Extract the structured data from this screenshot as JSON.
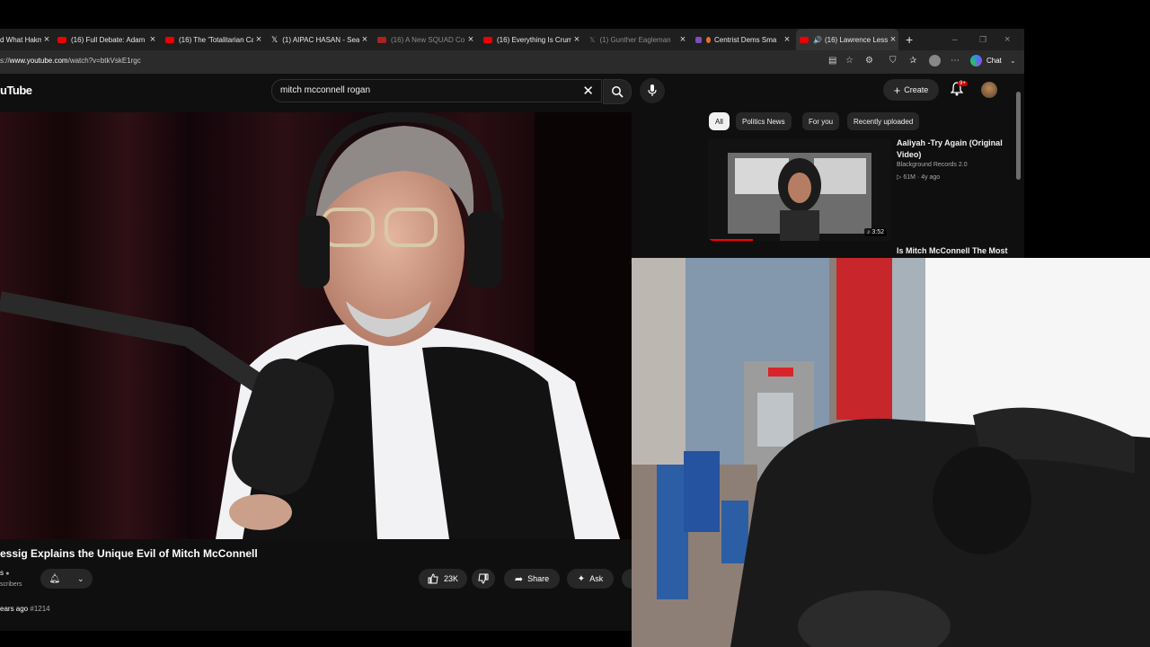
{
  "browser": {
    "tabs": [
      {
        "label": "d What Hakm",
        "dim": false,
        "favicon": "#666"
      },
      {
        "label": "(16) Full Debate: Adam",
        "dim": false,
        "favicon": "#e00"
      },
      {
        "label": "(16) The 'Totalitarian Ca",
        "dim": false,
        "favicon": "#e00"
      },
      {
        "label": "(1) AIPAC HASAN - Sear",
        "dim": false,
        "favicon": "#fff"
      },
      {
        "label": "(16) A New SQUAD Co",
        "dim": true,
        "favicon": "#e00"
      },
      {
        "label": "(16) Everything Is Crumb",
        "dim": false,
        "favicon": "#e00"
      },
      {
        "label": "(1) Gunther Eagleman",
        "dim": true,
        "favicon": "#777"
      },
      {
        "label": "Centrist Dems Sma",
        "dim": false,
        "favicon": "#e07030"
      },
      {
        "label": "(16) Lawrence Less",
        "dim": false,
        "favicon": "#e00",
        "active": true
      }
    ],
    "url_prefix": "s://",
    "url_host": "www.youtube.com",
    "url_path": "/watch?v=btkVskE1rgc",
    "chat_label": "Chat"
  },
  "youtube": {
    "logo": "uTube",
    "search_value": "mitch mcconnell rogan",
    "create_label": "Create",
    "notification_badge": "9+",
    "video": {
      "title": "essig Explains the Unique Evil of Mitch McConnell",
      "channel": "s",
      "subscribers": "scribers",
      "likes": "23K",
      "share_label": "Share",
      "ask_label": "Ask",
      "age": "ears ago",
      "hashtag": "#1214"
    },
    "chips": [
      "All",
      "Politics News",
      "For you",
      "Recently uploaded"
    ],
    "recommendations": [
      {
        "title": "Aaliyah -Try Again (Original Video)",
        "channel": "Blackground Records 2.0",
        "views": "61M",
        "age": "4y ago",
        "duration": "3:52"
      },
      {
        "title": "Is Mitch McConnell The Most"
      }
    ]
  },
  "colors": {
    "accent_red": "#ff0000",
    "yt_background": "#0f0f0f",
    "chip_bg": "#272727"
  }
}
